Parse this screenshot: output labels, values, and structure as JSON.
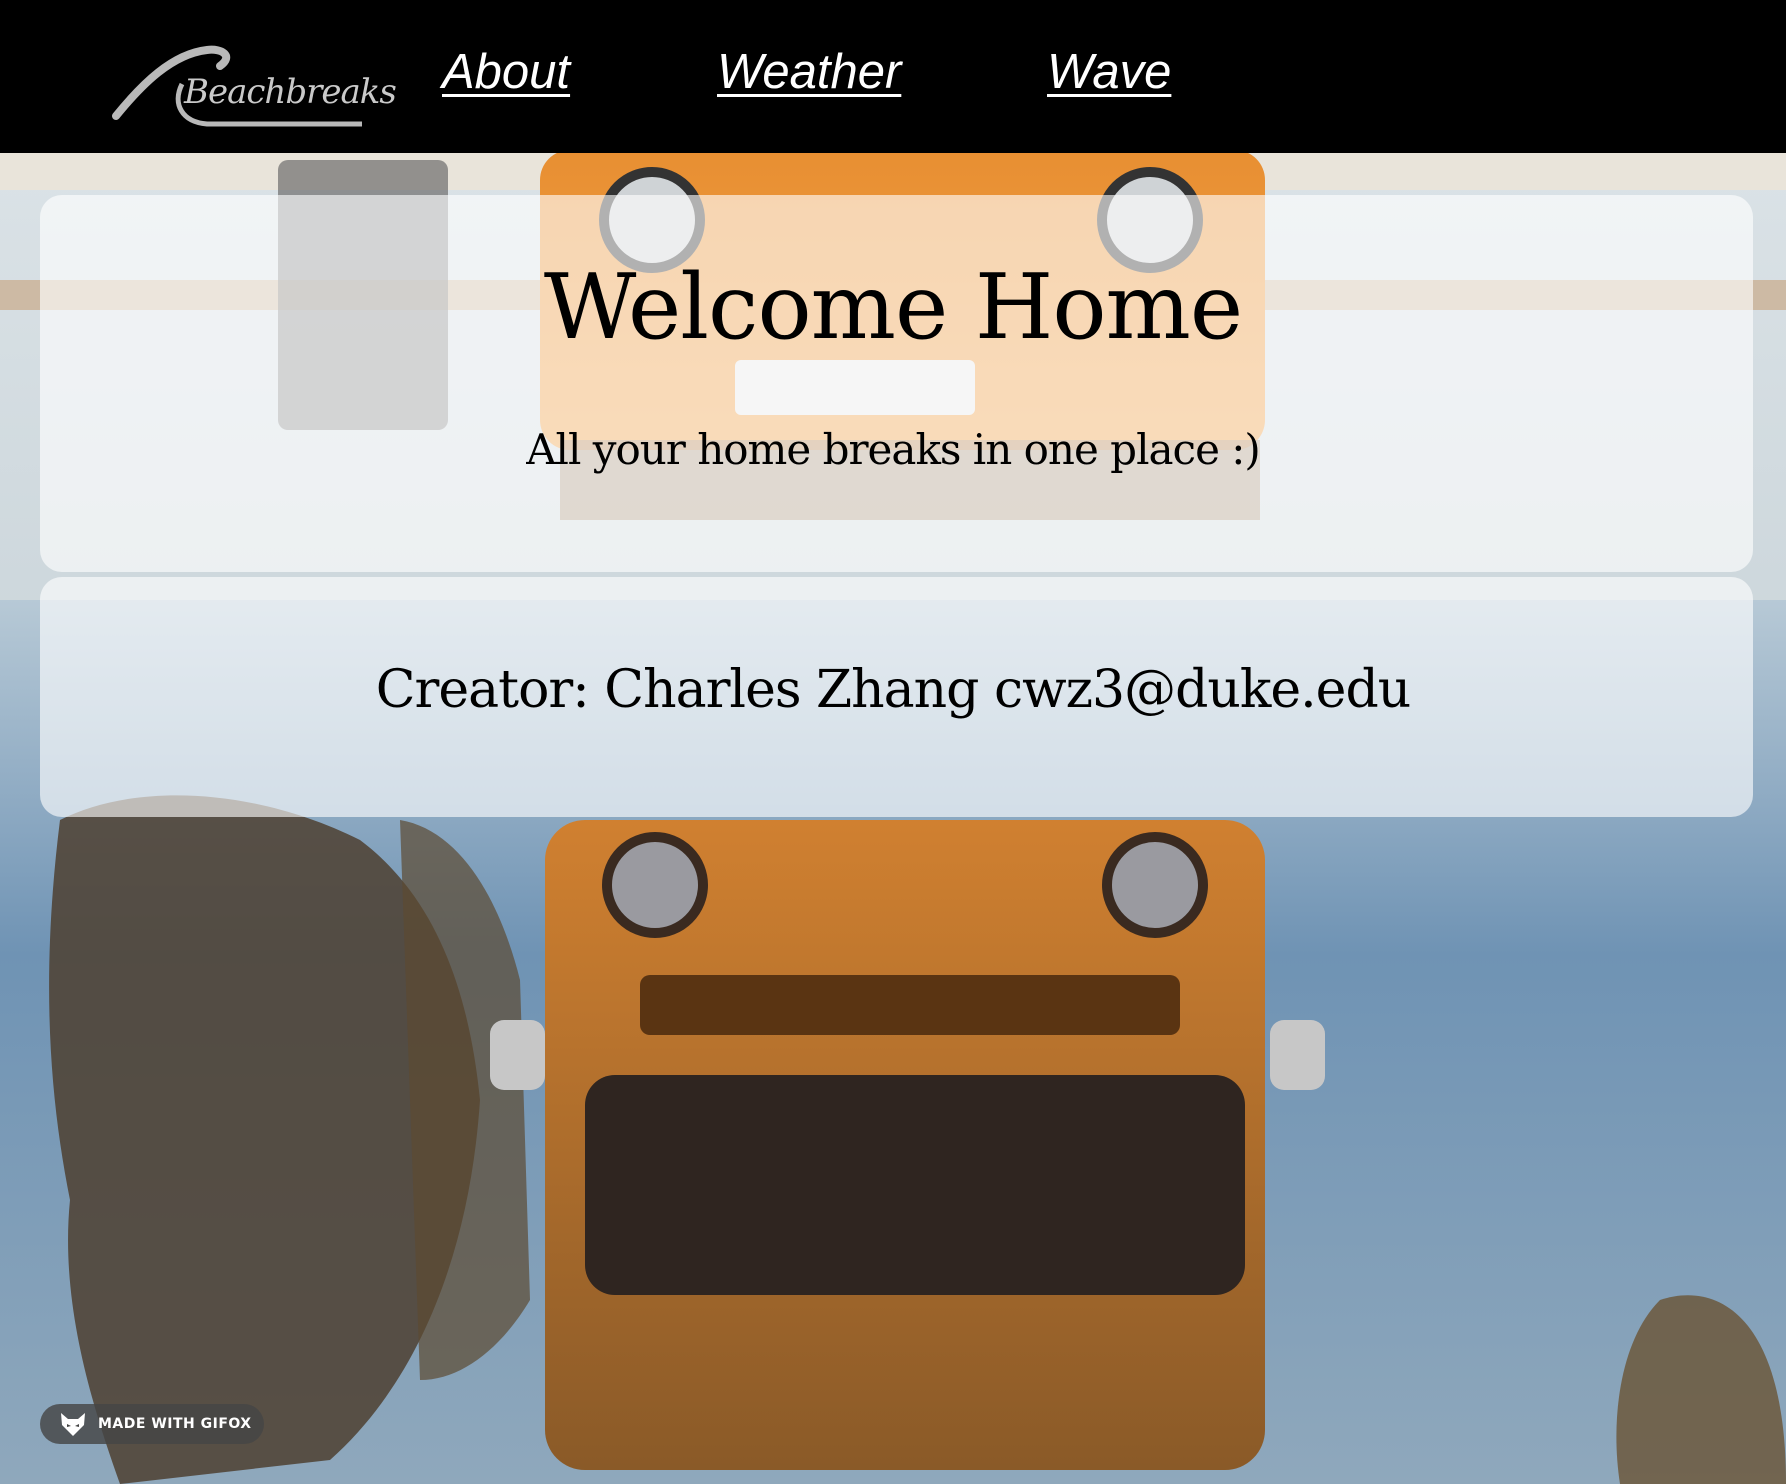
{
  "nav": {
    "logo_text": "Beachbreaks",
    "links": [
      "About",
      "Weather",
      "Wave"
    ]
  },
  "hero": {
    "title": "Welcome Home",
    "subtitle": "All your home breaks in one place :)"
  },
  "creator": {
    "line": "Creator: Charles Zhang cwz3@duke.edu"
  },
  "badge": {
    "text": "MADE WITH GIFOX",
    "icon": "fox-icon"
  },
  "background": {
    "description_icon": "beach-van-reflection-image"
  },
  "colors": {
    "navbar": "#000000",
    "nav_link": "#ffffff",
    "logo": "#c9c9c9",
    "van_orange": "#e38a2c",
    "card": "#ffffff"
  }
}
